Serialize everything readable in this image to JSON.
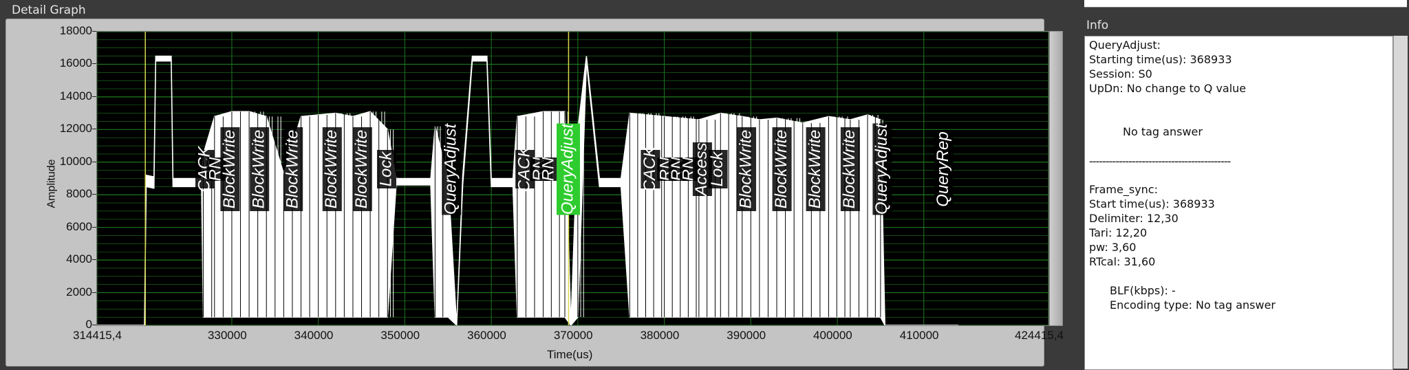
{
  "panels": {
    "detail_graph_title": "Detail Graph",
    "info_title": "Info"
  },
  "colors": {
    "plot_bg": "#000000",
    "grid": "#1f7a1f",
    "signal": "#ffffff",
    "cursor": "#d9d94a",
    "highlight": "#2ecc2e"
  },
  "chart_data": {
    "type": "line",
    "xlabel": "Time(us)",
    "ylabel": "Amplitude",
    "xlim": [
      314415.4,
      424415.4
    ],
    "ylim": [
      0,
      18000
    ],
    "x_ticks": [
      "314415,4",
      "330000",
      "340000",
      "350000",
      "360000",
      "370000",
      "380000",
      "390000",
      "400000",
      "410000",
      "424415,4"
    ],
    "x_tick_values": [
      314415.4,
      330000,
      340000,
      350000,
      360000,
      370000,
      380000,
      390000,
      400000,
      410000,
      424415.4
    ],
    "y_ticks": [
      "0",
      "2000",
      "4000",
      "6000",
      "8000",
      "10000",
      "12000",
      "14000",
      "16000",
      "18000"
    ],
    "y_tick_values": [
      0,
      2000,
      4000,
      6000,
      8000,
      10000,
      12000,
      14000,
      16000,
      18000
    ],
    "grid": true,
    "cursors_x": [
      320000,
      368933
    ],
    "series": [
      {
        "envelope": [
          [
            314415,
            0,
            0
          ],
          [
            319900,
            0,
            0
          ],
          [
            320100,
            8500,
            9200
          ],
          [
            321000,
            8400,
            9100
          ],
          [
            321200,
            16200,
            16500
          ],
          [
            323000,
            16200,
            16500
          ],
          [
            323200,
            8500,
            9000
          ],
          [
            326500,
            8500,
            9000
          ],
          [
            326700,
            500,
            10500
          ],
          [
            328000,
            500,
            12800
          ],
          [
            330000,
            500,
            13100
          ],
          [
            332000,
            500,
            13100
          ],
          [
            334000,
            500,
            12800
          ],
          [
            336000,
            500,
            9300
          ],
          [
            338000,
            500,
            12800
          ],
          [
            340000,
            500,
            12900
          ],
          [
            342000,
            500,
            13000
          ],
          [
            344000,
            500,
            12800
          ],
          [
            346000,
            500,
            13100
          ],
          [
            348000,
            500,
            12000
          ],
          [
            349000,
            8600,
            9000
          ],
          [
            353000,
            8600,
            9000
          ],
          [
            353500,
            500,
            12200
          ],
          [
            355000,
            500,
            9000
          ],
          [
            356000,
            0,
            0
          ],
          [
            356700,
            8600,
            9200
          ],
          [
            357800,
            16200,
            16500
          ],
          [
            359500,
            16200,
            16500
          ],
          [
            360000,
            8500,
            9000
          ],
          [
            362500,
            8500,
            9000
          ],
          [
            363000,
            500,
            12800
          ],
          [
            366000,
            500,
            13100
          ],
          [
            368500,
            500,
            13100
          ],
          [
            369200,
            0,
            0
          ],
          [
            370000,
            500,
            12000
          ],
          [
            371000,
            16200,
            16500
          ],
          [
            372500,
            8500,
            9000
          ],
          [
            375000,
            8500,
            9000
          ],
          [
            376000,
            500,
            13000
          ],
          [
            380000,
            500,
            12800
          ],
          [
            384000,
            500,
            12600
          ],
          [
            386500,
            500,
            13000
          ],
          [
            389000,
            500,
            12800
          ],
          [
            391000,
            500,
            12600
          ],
          [
            393000,
            500,
            12700
          ],
          [
            396000,
            500,
            12400
          ],
          [
            399000,
            500,
            12800
          ],
          [
            401500,
            500,
            12600
          ],
          [
            403500,
            500,
            12900
          ],
          [
            405000,
            500,
            12600
          ],
          [
            405500,
            0,
            0
          ],
          [
            414000,
            0,
            0
          ]
        ]
      }
    ],
    "annotations": [
      {
        "x": 326900,
        "text": "CACK",
        "highlight": false
      },
      {
        "x": 328200,
        "text": "RN",
        "highlight": false
      },
      {
        "x": 329800,
        "text": "BlockWrite",
        "highlight": false
      },
      {
        "x": 333200,
        "text": "BlockWrite",
        "highlight": false
      },
      {
        "x": 337100,
        "text": "BlockWrite",
        "highlight": false
      },
      {
        "x": 341600,
        "text": "BlockWrite",
        "highlight": false
      },
      {
        "x": 345100,
        "text": "BlockWrite",
        "highlight": false
      },
      {
        "x": 347900,
        "text": "Lock",
        "highlight": false
      },
      {
        "x": 355400,
        "text": "QueryAdjust",
        "highlight": false
      },
      {
        "x": 363900,
        "text": "CACK",
        "highlight": false
      },
      {
        "x": 365600,
        "text": "RN",
        "highlight": false
      },
      {
        "x": 366700,
        "text": "RN",
        "highlight": false
      },
      {
        "x": 368900,
        "text": "QueryAdjust",
        "highlight": true
      },
      {
        "x": 378400,
        "text": "CACK",
        "highlight": false
      },
      {
        "x": 380300,
        "text": "RN",
        "highlight": false
      },
      {
        "x": 381600,
        "text": "RN",
        "highlight": false
      },
      {
        "x": 382900,
        "text": "RN",
        "highlight": false
      },
      {
        "x": 384400,
        "text": "Access",
        "highlight": false
      },
      {
        "x": 386200,
        "text": "Lock",
        "highlight": false
      },
      {
        "x": 389500,
        "text": "BlockWrite",
        "highlight": false
      },
      {
        "x": 393600,
        "text": "BlockWrite",
        "highlight": false
      },
      {
        "x": 397500,
        "text": "BlockWrite",
        "highlight": false
      },
      {
        "x": 401500,
        "text": "BlockWrite",
        "highlight": false
      },
      {
        "x": 405200,
        "text": "QueryAdjust",
        "highlight": false
      },
      {
        "x": 412300,
        "text": "QueryRep",
        "highlight": false
      }
    ]
  },
  "info": {
    "lines": [
      "QueryAdjust:",
      "Starting time(us): 368933",
      "Session: S0",
      "UpDn: No change to Q value",
      "No tag answer",
      "-------------------------------------------",
      "Frame_sync:",
      "Start time(us): 368933",
      "Delimiter: 12,30",
      "Tari: 12,20",
      "pw: 3,60",
      "RTcal: 31,60",
      "BLF(kbps): -",
      "Encoding type: No tag answer"
    ]
  }
}
